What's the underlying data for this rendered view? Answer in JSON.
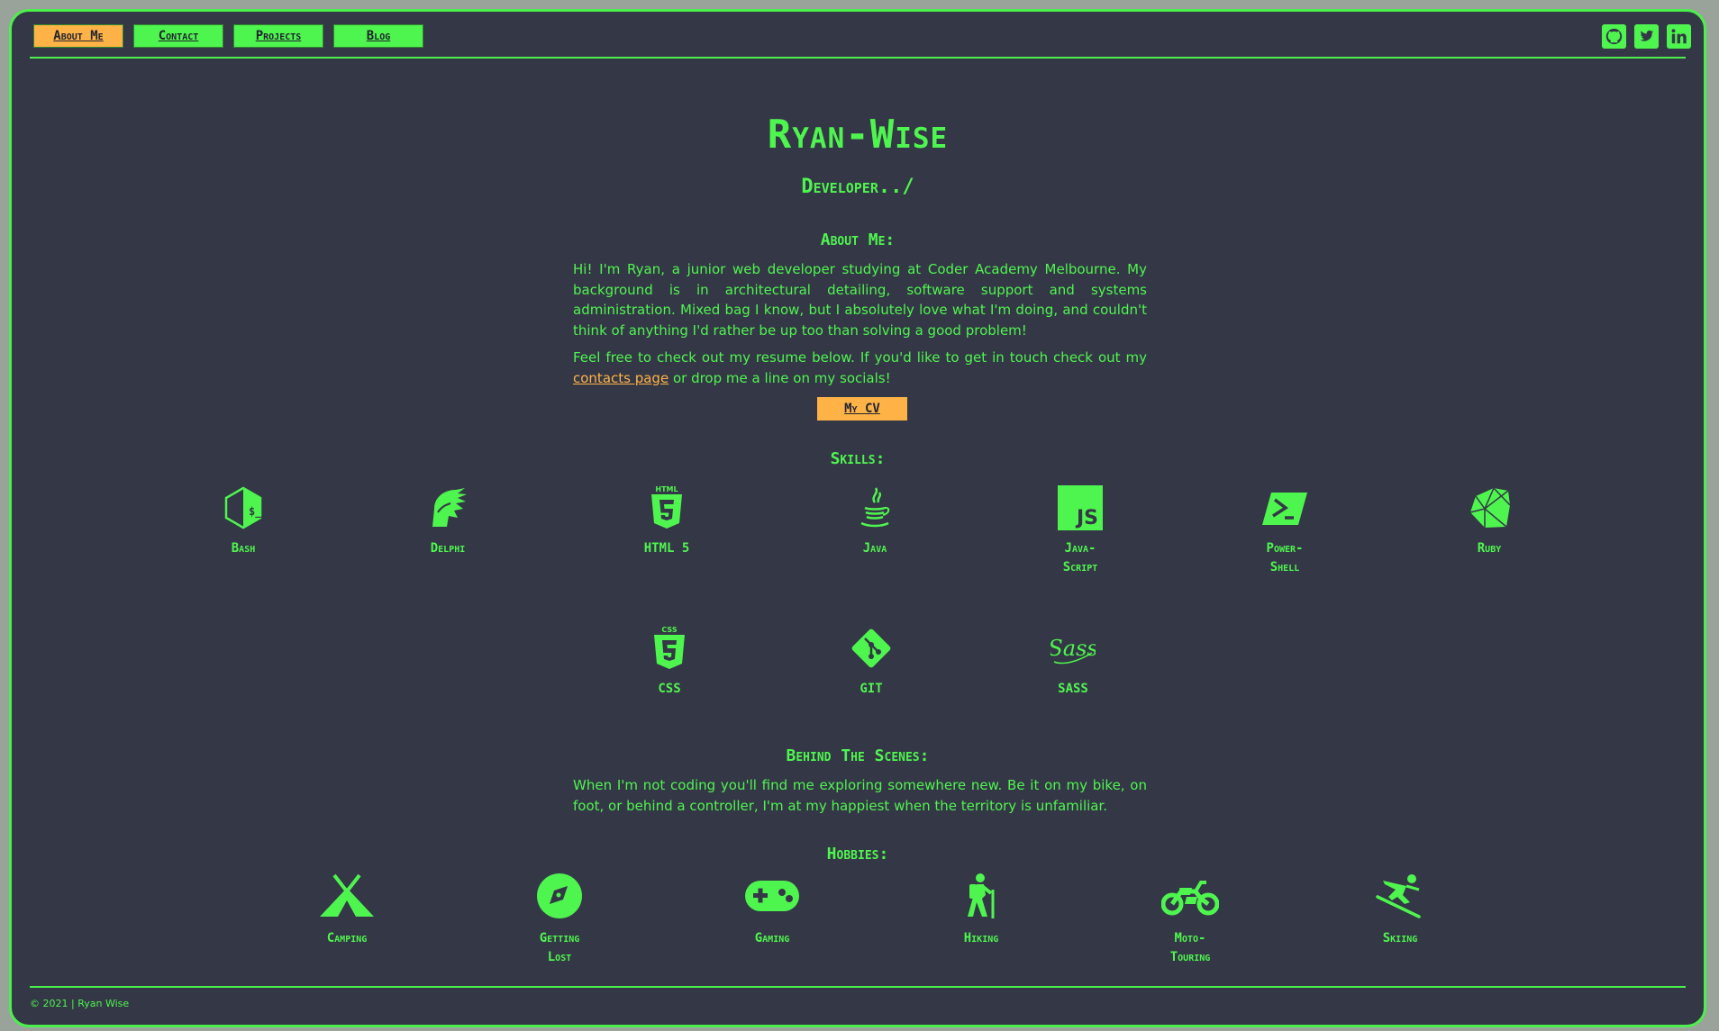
{
  "nav": {
    "items": [
      "About Me",
      "Contact",
      "Projects",
      "Blog"
    ],
    "active": "About Me"
  },
  "socials": [
    "github-icon",
    "twitter-icon",
    "linkedin-icon"
  ],
  "header": {
    "name": "Ryan-Wise",
    "tagline": "Developer../"
  },
  "about": {
    "heading": "About Me:",
    "p1": "Hi! I'm Ryan, a junior web developer studying at Coder Academy Melbourne. My background is in architectural detailing, software support and systems administration. Mixed bag I know, but I absolutely love what I'm doing, and couldn't think of anything I'd rather be up too than solving a good problem!",
    "p2_before": "Feel free to check out my resume below. If you'd like to get in touch check out my ",
    "p2_link": "contacts page",
    "p2_after": " or drop me a line on my socials!",
    "cv_button": "My CV"
  },
  "skills": {
    "heading": "Skills:",
    "items": [
      {
        "label": "Bash",
        "icon": "bash-icon"
      },
      {
        "label": "Delphi",
        "icon": "delphi-icon"
      },
      {
        "label": "HTML 5",
        "icon": "html5-icon"
      },
      {
        "label": "Java",
        "icon": "java-icon"
      },
      {
        "label": "Java-\nScript",
        "icon": "javascript-icon"
      },
      {
        "label": "Power-\nShell",
        "icon": "powershell-icon"
      },
      {
        "label": "Ruby",
        "icon": "ruby-icon"
      },
      {
        "label": "CSS",
        "icon": "css3-icon"
      },
      {
        "label": "GIT",
        "icon": "git-icon"
      },
      {
        "label": "SASS",
        "icon": "sass-icon"
      }
    ]
  },
  "behind": {
    "heading": "Behind The Scenes:",
    "text": "When I'm not coding you'll find me exploring somewhere new. Be it on my bike, on foot, or behind a controller, I'm at my happiest when the territory is unfamiliar."
  },
  "hobbies": {
    "heading": "Hobbies:",
    "items": [
      {
        "label": "Camping",
        "icon": "tent-icon"
      },
      {
        "label": "Getting\nLost",
        "icon": "compass-icon"
      },
      {
        "label": "Gaming",
        "icon": "gamepad-icon"
      },
      {
        "label": "Hiking",
        "icon": "hiker-icon"
      },
      {
        "label": "Moto-\nTouring",
        "icon": "motorcycle-icon"
      },
      {
        "label": "Skiing",
        "icon": "skier-icon"
      }
    ]
  },
  "footer": {
    "text": "© 2021 | Ryan Wise"
  },
  "colors": {
    "background": "#343746",
    "accent": "#4ff54f",
    "highlight": "#ffb347"
  }
}
